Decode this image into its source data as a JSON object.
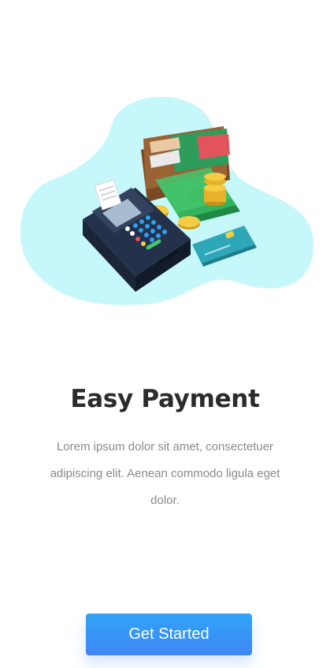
{
  "onboarding": {
    "illustration": {
      "icon": "payment-terminal-wallet-illustration",
      "blob_color": "#c5f7fb"
    },
    "title": "Easy Payment",
    "description": "Lorem ipsum dolor sit amet, consectetuer adipiscing elit. Aenean commodo ligula eget dolor.",
    "cta_label": "Get Started",
    "colors": {
      "accent": "#3f87f5",
      "title": "#2b2b2b",
      "body_text": "#8a8a8a"
    }
  }
}
